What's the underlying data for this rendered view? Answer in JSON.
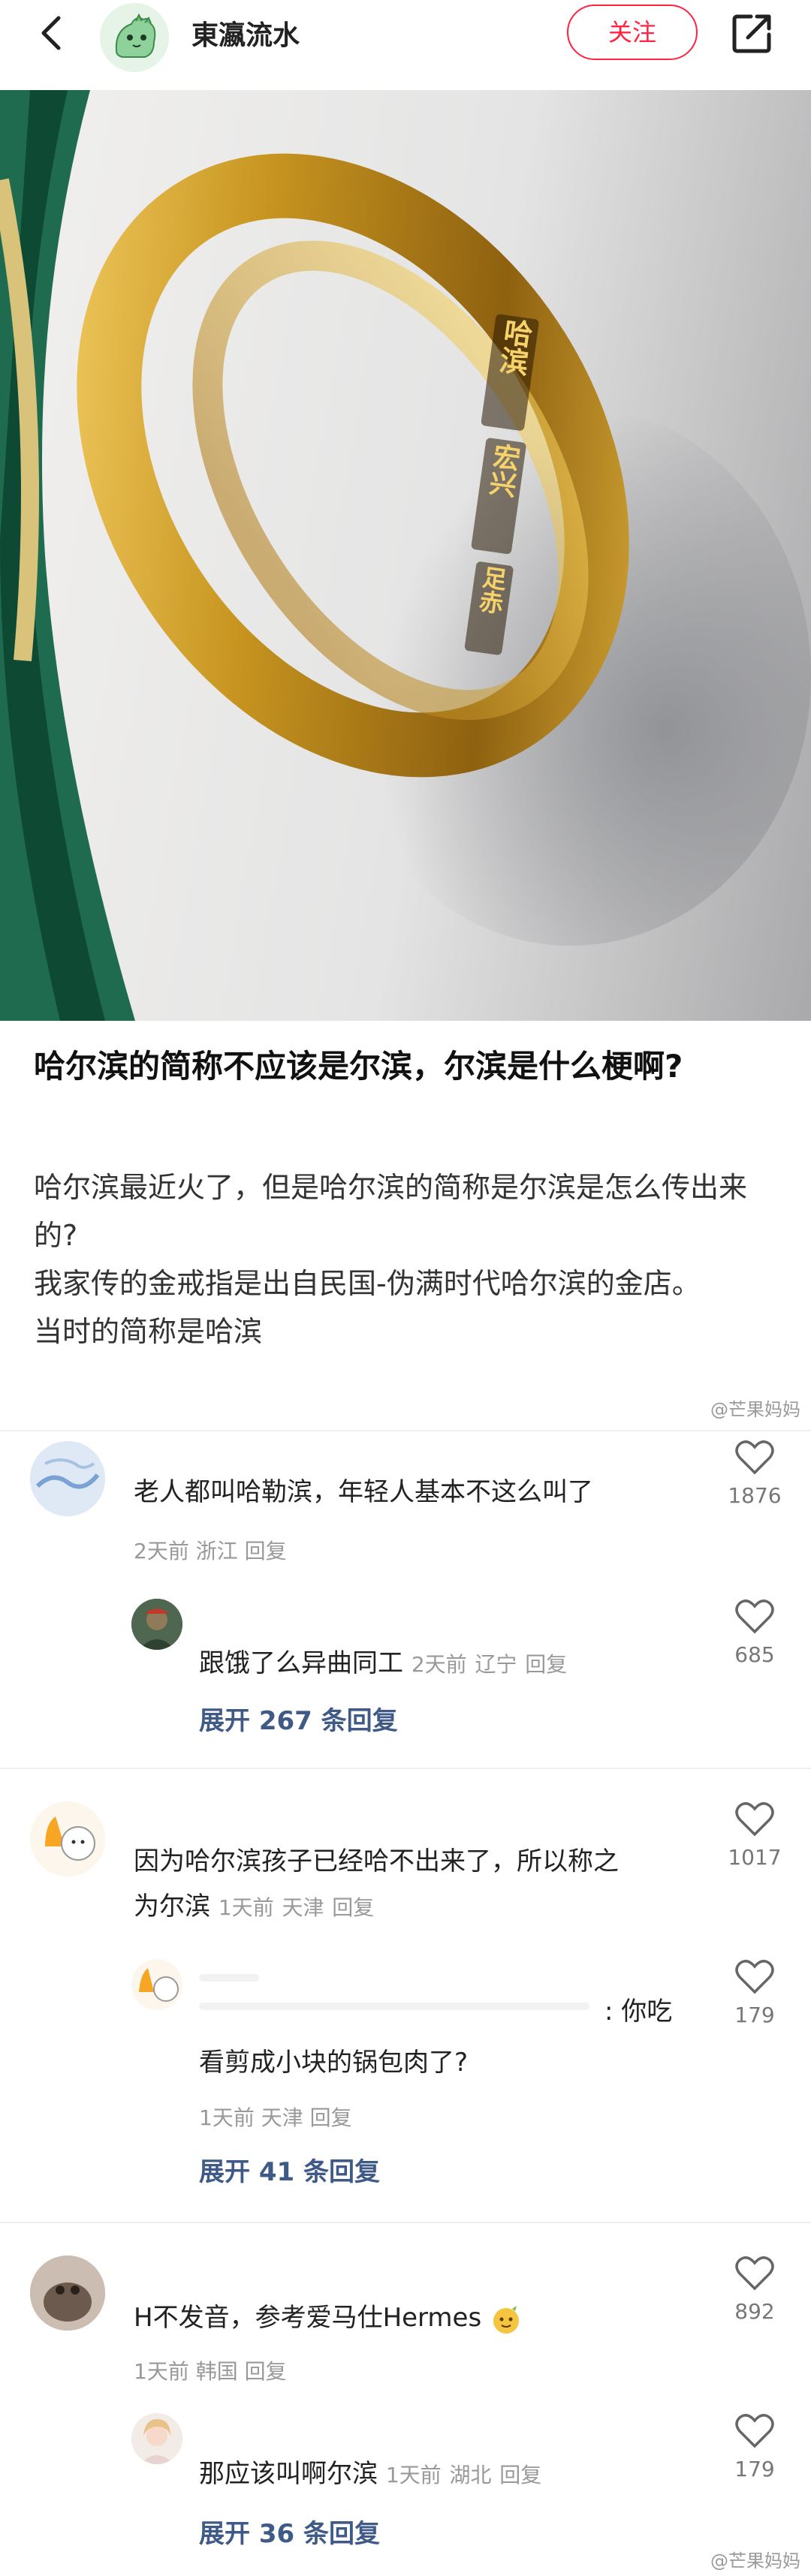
{
  "header": {
    "author": "東瀛流水",
    "follow_label": "关注",
    "back_icon": "chevron-left-icon",
    "share_icon": "share-icon"
  },
  "ring": {
    "engraving_left": "哈滨",
    "engraving_mid": "宏兴",
    "engraving_right": "足赤"
  },
  "post": {
    "title": "哈尔滨的简称不应该是尔滨，尔滨是什么梗啊?",
    "lines": [
      "哈尔滨最近火了，但是哈尔滨的简称是尔滨是怎么传出来的?",
      "我家传的金戒指是出自民国-伪满时代哈尔滨的金店。",
      "当时的简称是哈滨"
    ]
  },
  "watermark": "@芒果妈妈",
  "comments": [
    {
      "text": "老人都叫哈勒滨，年轻人基本不这么叫了",
      "time": "2天前",
      "location": "浙江",
      "reply_label": "回复",
      "likes": "1876",
      "reply": {
        "text": "跟饿了么异曲同工",
        "time": "2天前",
        "location": "辽宁",
        "reply_label": "回复",
        "likes": "685"
      },
      "expand": "展开 267 条回复"
    },
    {
      "text_line1": "因为哈尔滨孩子已经哈不出来了，所以称之",
      "text_line2": "为尔滨",
      "time": "1天前",
      "location": "天津",
      "reply_label": "回复",
      "likes": "1017",
      "reply": {
        "text_line1": ": 你吃",
        "text_line2": "看剪成小块的锅包肉了?",
        "time": "1天前",
        "location": "天津",
        "reply_label": "回复",
        "likes": "179"
      },
      "expand": "展开 41 条回复"
    },
    {
      "text": "H不发音，参考爱马仕Hermes",
      "time": "1天前",
      "location": "韩国",
      "reply_label": "回复",
      "likes": "892",
      "reply": {
        "text": "那应该叫啊尔滨",
        "time": "1天前",
        "location": "湖北",
        "reply_label": "回复",
        "likes": "179"
      },
      "expand": "展开 36 条回复"
    }
  ],
  "colors": {
    "accent": "#ff2442",
    "link": "#3f5a87",
    "meta": "#999999"
  }
}
